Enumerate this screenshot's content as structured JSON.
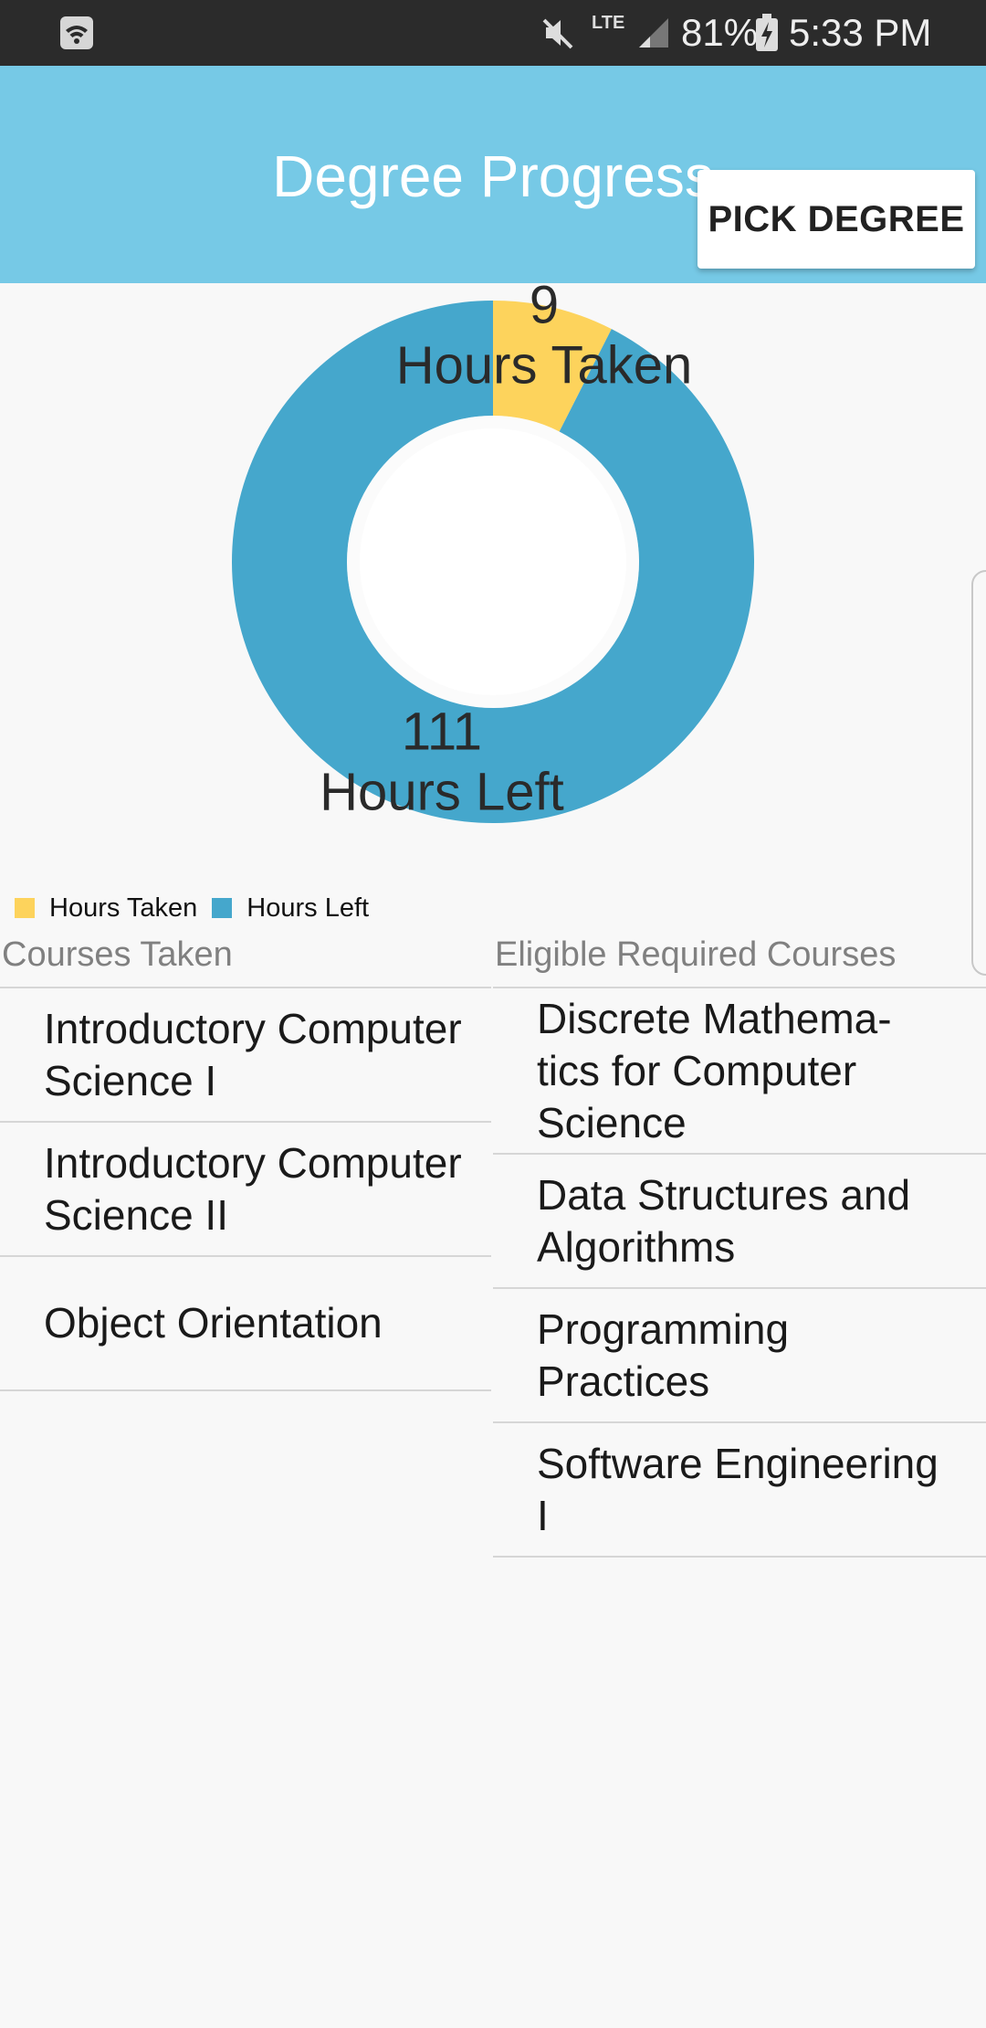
{
  "status_bar": {
    "battery_percent": "81%",
    "time": "5:33 PM",
    "network": "LTE",
    "icons": [
      "wifi-icon",
      "mute-icon",
      "signal-icon",
      "battery-charging-icon"
    ]
  },
  "app_bar": {
    "title": "Degree Progress",
    "pick_degree_label": "PICK DEGREE",
    "background_color": "#76c9e6"
  },
  "chart_data": {
    "type": "pie",
    "variant": "donut",
    "slices": [
      {
        "name": "Hours Taken",
        "value": 9,
        "color": "#fdd35c"
      },
      {
        "name": "Hours Left",
        "value": 111,
        "color": "#45a7cc"
      }
    ],
    "legend": [
      "Hours Taken",
      "Hours Left"
    ],
    "legend_position": "bottom-left"
  },
  "courses_taken": {
    "header": "Courses Taken",
    "items": [
      "Introductory Computer Science I",
      "Introductory Computer Science II",
      "Object Orientation"
    ]
  },
  "eligible_courses": {
    "header": "Eligible Required Courses",
    "items": [
      "Discrete Mathema-tics for Computer Science",
      "Data Structures and Algorithms",
      "Programming Practices",
      "Software Engineering I"
    ]
  }
}
